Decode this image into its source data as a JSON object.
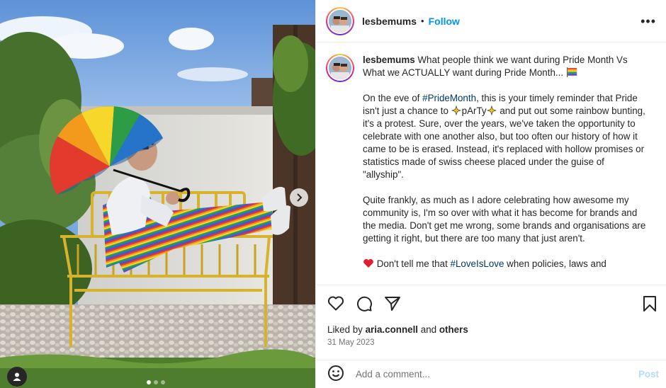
{
  "post": {
    "author": "lesbemums",
    "header_separator": "•",
    "follow_label": "Follow",
    "more_label": "•••",
    "caption": {
      "title": "What people think we want during Pride Month Vs What we ACTUALLY want during Pride Month...",
      "para1_a": "On the eve of ",
      "para1_tag": "#PrideMonth",
      "para1_b": ", this is your timely reminder that Pride isn't just a chance to ",
      "para1_party": "pArTy",
      "para1_c": " and put out some rainbow bunting, it's a protest. Sure, over the years, we've taken the opportunity to celebrate with one another also, but too often our history of how it came to be is erased. Instead, it's replaced with hollow promises or statistics made of swiss cheese placed under the guise of \"allyship\".",
      "para2": "Quite frankly, as much as I adore celebrating how awesome my community is, I'm so over with what it has become for brands and the media. Don't get me wrong, some brands and organisations are getting it right, but there are too many that just aren't.",
      "para3_a": "Don't tell me that ",
      "para3_tag": "#LoveIsLove",
      "para3_b": " when policies, laws and"
    },
    "likes": {
      "prefix": "Liked by",
      "user": "aria.connell",
      "conj": "and",
      "others": "others"
    },
    "date": "31 May 2023",
    "comment": {
      "placeholder": "Add a comment...",
      "post_label": "Post"
    }
  },
  "icons": {
    "like": "heart-icon",
    "comment": "comment-icon",
    "share": "send-icon",
    "save": "bookmark-icon",
    "emoji": "smiley-icon",
    "next": "chevron-right-icon",
    "tagged": "user-icon"
  },
  "colors": {
    "link_blue": "#0095f6",
    "hashtag": "#00376b",
    "post_disabled": "#b3dbff",
    "muted": "#737373"
  },
  "carousel": {
    "total": 3,
    "active": 1
  }
}
